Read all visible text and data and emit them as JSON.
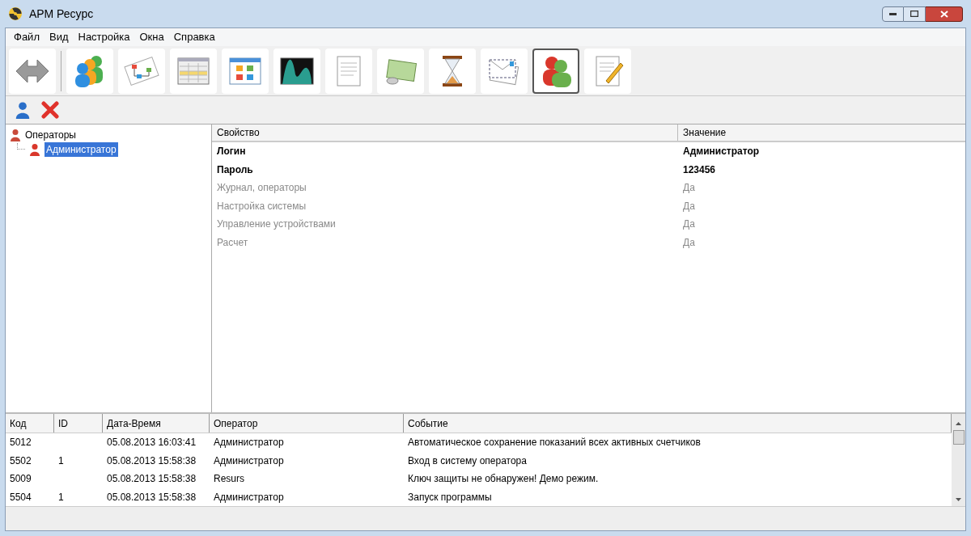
{
  "window": {
    "title": "АРМ Ресурс"
  },
  "menu": [
    "Файл",
    "Вид",
    "Настройка",
    "Окна",
    "Справка"
  ],
  "toolbar": [
    {
      "kind": "arrows",
      "selected": false
    },
    {
      "kind": "people",
      "selected": false
    },
    {
      "kind": "diagram",
      "selected": false
    },
    {
      "kind": "table",
      "selected": false
    },
    {
      "kind": "tiles",
      "selected": false
    },
    {
      "kind": "graph",
      "selected": false
    },
    {
      "kind": "document",
      "selected": false
    },
    {
      "kind": "money",
      "selected": false
    },
    {
      "kind": "hourglass",
      "selected": false
    },
    {
      "kind": "envelope",
      "selected": false
    },
    {
      "kind": "operators",
      "selected": true
    },
    {
      "kind": "edit",
      "selected": false
    }
  ],
  "actions": [
    {
      "kind": "add"
    },
    {
      "kind": "delete"
    }
  ],
  "tree": {
    "label": "Операторы",
    "expanded": true,
    "children": [
      {
        "label": "Администратор",
        "selected": true
      }
    ]
  },
  "properties": {
    "columns": [
      "Свойство",
      "Значение"
    ],
    "rows": [
      {
        "name": "Логин",
        "value": "Администратор",
        "disabled": false
      },
      {
        "name": "Пароль",
        "value": "123456",
        "disabled": false
      },
      {
        "name": "Журнал, операторы",
        "value": "Да",
        "disabled": true
      },
      {
        "name": "Настройка системы",
        "value": "Да",
        "disabled": true
      },
      {
        "name": "Управление устройствами",
        "value": "Да",
        "disabled": true
      },
      {
        "name": "Расчет",
        "value": "Да",
        "disabled": true
      }
    ]
  },
  "log": {
    "columns": [
      "Код",
      "ID",
      "Дата-Время",
      "Оператор",
      "Событие"
    ],
    "rows": [
      [
        "5012",
        "",
        "05.08.2013 16:03:41",
        "Администратор",
        "Автоматическое сохранение показаний всех активных счетчиков"
      ],
      [
        "5502",
        "1",
        "05.08.2013 15:58:38",
        "Администратор",
        "Вход в систему оператора"
      ],
      [
        "5009",
        "",
        "05.08.2013 15:58:38",
        "Resurs",
        "Ключ защиты не обнаружен! Демо режим."
      ],
      [
        "5504",
        "1",
        "05.08.2013 15:58:38",
        "Администратор",
        "Запуск программы"
      ]
    ]
  }
}
